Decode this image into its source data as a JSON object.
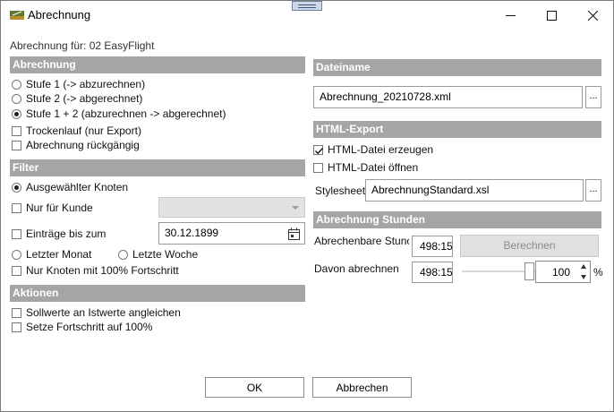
{
  "window": {
    "title": "Abrechnung",
    "controls": {
      "minimize": "minimize-icon",
      "maximize": "maximize-icon",
      "close": "close-icon"
    }
  },
  "context_label": "Abrechnung für: 02 EasyFlight",
  "left": {
    "abrechnung": {
      "header": "Abrechnung",
      "options": [
        {
          "label": "Stufe 1 (-> abzurechnen)",
          "selected": false
        },
        {
          "label": "Stufe 2 (-> abgerechnet)",
          "selected": false
        },
        {
          "label": "Stufe 1 + 2 (abzurechnen -> abgerechnet)",
          "selected": true
        }
      ],
      "trockenlauf": {
        "label": "Trockenlauf (nur Export)",
        "checked": false
      },
      "rueckgaengig": {
        "label": "Abrechnung rückgängig",
        "checked": false
      }
    },
    "filter": {
      "header": "Filter",
      "ausgewaehlter_knoten": {
        "label": "Ausgewählter Knoten",
        "selected": true
      },
      "nur_fuer_kunde": {
        "label": "Nur für Kunde",
        "checked": false,
        "value": ""
      },
      "eintraege_bis_zum": {
        "label": "Einträge bis zum",
        "checked": false,
        "date": "30.12.1899"
      },
      "letzter_monat": {
        "label": "Letzter Monat",
        "selected": false
      },
      "letzte_woche": {
        "label": "Letzte Woche",
        "selected": false
      },
      "nur_knoten_100": {
        "label": "Nur Knoten mit 100% Fortschritt",
        "checked": false
      }
    },
    "aktionen": {
      "header": "Aktionen",
      "sollwerte": {
        "label": "Sollwerte an Istwerte angleichen",
        "checked": false
      },
      "fortschritt": {
        "label": "Setze Fortschritt auf 100%",
        "checked": false
      }
    }
  },
  "right": {
    "dateiname": {
      "header": "Dateiname",
      "value": "Abrechnung_20210728.xml",
      "browse": "..."
    },
    "html_export": {
      "header": "HTML-Export",
      "erzeugen": {
        "label": "HTML-Datei erzeugen",
        "checked": true
      },
      "oeffnen": {
        "label": "HTML-Datei öffnen",
        "checked": false
      },
      "stylesheet_label": "Stylesheet",
      "stylesheet_value": "AbrechnungStandard.xsl",
      "browse": "..."
    },
    "stunden": {
      "header": "Abrechnung Stunden",
      "abrechenbare_label": "Abrechenbare Stunc",
      "abrechenbare_value": "498:15",
      "berechnen": "Berechnen",
      "davon_label": "Davon abrechnen",
      "davon_value": "498:15",
      "percent_value": "100",
      "percent_unit": "%",
      "slider_fraction": 1.0
    }
  },
  "buttons": {
    "ok": "OK",
    "cancel": "Abbrechen"
  }
}
